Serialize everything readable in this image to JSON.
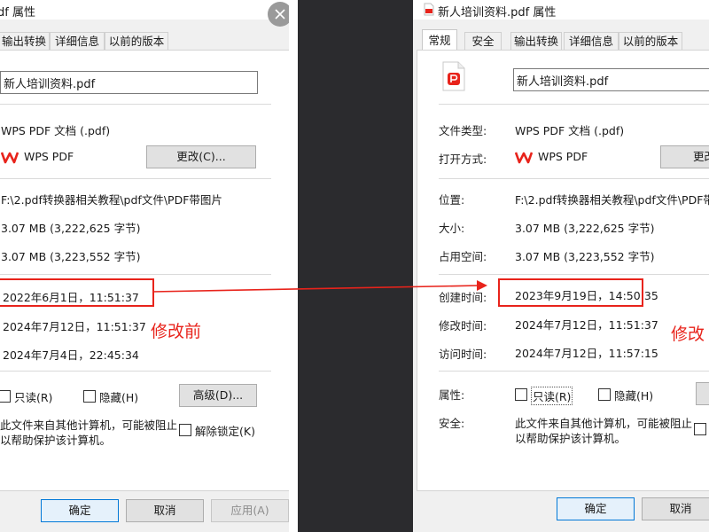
{
  "left": {
    "title": "df 属性",
    "tabs": [
      "输出转换",
      "详细信息",
      "以前的版本"
    ],
    "filename": "新人培训资料.pdf",
    "file_type": "WPS PDF 文档 (.pdf)",
    "open_with": "WPS PDF",
    "change_btn": "更改(C)...",
    "location": "F:\\2.pdf转换器相关教程\\pdf文件\\PDF带图片",
    "size": "3.07 MB (3,222,625 字节)",
    "size_on_disk": "3.07 MB (3,223,552 字节)",
    "created": "2022年6月1日，11:51:37",
    "modified": "2024年7月12日，11:51:37",
    "accessed": "2024年7月4日，22:45:34",
    "note": "修改前",
    "readonly": "只读(R)",
    "hidden": "隐藏(H)",
    "advanced_btn": "高级(D)...",
    "security_line1": "此文件来自其他计算机，可能被阻止",
    "security_line2": "以帮助保护该计算机。",
    "unblock": "解除锁定(K)",
    "ok": "确定",
    "cancel": "取消",
    "apply": "应用(A)"
  },
  "right": {
    "title": "新人培训资料.pdf 属性",
    "tabs": [
      "常规",
      "安全",
      "输出转换",
      "详细信息",
      "以前的版本"
    ],
    "filename": "新人培训资料.pdf",
    "labels": {
      "file_type": "文件类型:",
      "open_with": "打开方式:",
      "location": "位置:",
      "size": "大小:",
      "size_on_disk": "占用空间:",
      "created": "创建时间:",
      "modified": "修改时间:",
      "accessed": "访问时间:",
      "attributes": "属性:",
      "security": "安全:"
    },
    "file_type": "WPS PDF 文档 (.pdf)",
    "open_with": "WPS PDF",
    "change_btn": "更改",
    "location": "F:\\2.pdf转换器相关教程\\pdf文件\\PDF带图",
    "size": "3.07 MB (3,222,625 字节)",
    "size_on_disk": "3.07 MB (3,223,552 字节)",
    "created": "2023年9月19日，14:50:35",
    "modified": "2024年7月12日，11:51:37",
    "accessed": "2024年7月12日，11:57:15",
    "note": "修改",
    "readonly": "只读(R)",
    "hidden": "隐藏(H)",
    "security_line1": "此文件来自其他计算机，可能被阻止",
    "security_line2": "以帮助保护该计算机。",
    "ok": "确定",
    "cancel": "取消"
  },
  "colors": {
    "annotation": "#e8231b",
    "wps": "#e8231b",
    "accent": "#0078d7"
  },
  "icons": {
    "close": "close-icon",
    "wps": "wps-logo-icon",
    "pdf": "pdf-file-icon"
  }
}
